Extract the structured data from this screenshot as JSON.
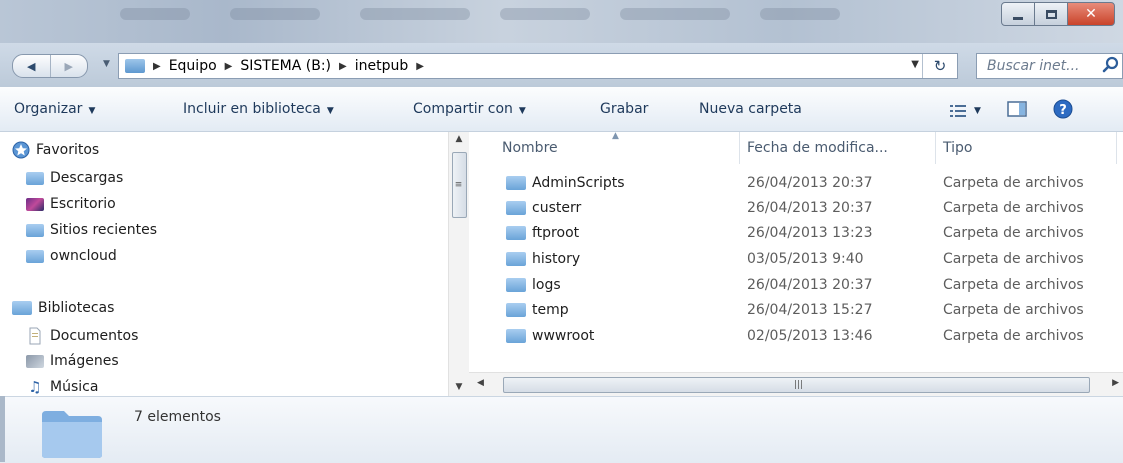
{
  "window": {
    "controls": {
      "minimize_icon": "minimize-icon",
      "maximize_icon": "maximize-icon",
      "close_icon": "close-icon"
    }
  },
  "address_bar": {
    "breadcrumb": [
      "Equipo",
      "SISTEMA (B:)",
      "inetpub"
    ]
  },
  "search": {
    "placeholder": "Buscar inet..."
  },
  "toolbar": {
    "organize": "Organizar",
    "include_library": "Incluir en biblioteca",
    "share_with": "Compartir con",
    "burn": "Grabar",
    "new_folder": "Nueva carpeta"
  },
  "sidebar": {
    "favorites": {
      "label": "Favoritos",
      "items": [
        {
          "label": "Descargas",
          "icon": "downloads-folder-icon"
        },
        {
          "label": "Escritorio",
          "icon": "desktop-icon"
        },
        {
          "label": "Sitios recientes",
          "icon": "recent-places-icon"
        },
        {
          "label": "owncloud",
          "icon": "folder-icon"
        }
      ]
    },
    "libraries": {
      "label": "Bibliotecas",
      "items": [
        {
          "label": "Documentos",
          "icon": "documents-icon"
        },
        {
          "label": "Imágenes",
          "icon": "pictures-icon"
        },
        {
          "label": "Música",
          "icon": "music-icon"
        }
      ]
    }
  },
  "file_list": {
    "columns": [
      "Nombre",
      "Fecha de modifica...",
      "Tipo"
    ],
    "rows": [
      {
        "name": "AdminScripts",
        "date": "26/04/2013 20:37",
        "type": "Carpeta de archivos"
      },
      {
        "name": "custerr",
        "date": "26/04/2013 20:37",
        "type": "Carpeta de archivos"
      },
      {
        "name": "ftproot",
        "date": "26/04/2013 13:23",
        "type": "Carpeta de archivos"
      },
      {
        "name": "history",
        "date": "03/05/2013 9:40",
        "type": "Carpeta de archivos"
      },
      {
        "name": "logs",
        "date": "26/04/2013 20:37",
        "type": "Carpeta de archivos"
      },
      {
        "name": "temp",
        "date": "26/04/2013 15:27",
        "type": "Carpeta de archivos"
      },
      {
        "name": "wwwroot",
        "date": "02/05/2013 13:46",
        "type": "Carpeta de archivos"
      }
    ]
  },
  "details": {
    "count": "7 elementos"
  },
  "colors": {
    "folder": "#6aa3d8",
    "toolbar_text": "#1e395b",
    "close": "#c9432a"
  }
}
